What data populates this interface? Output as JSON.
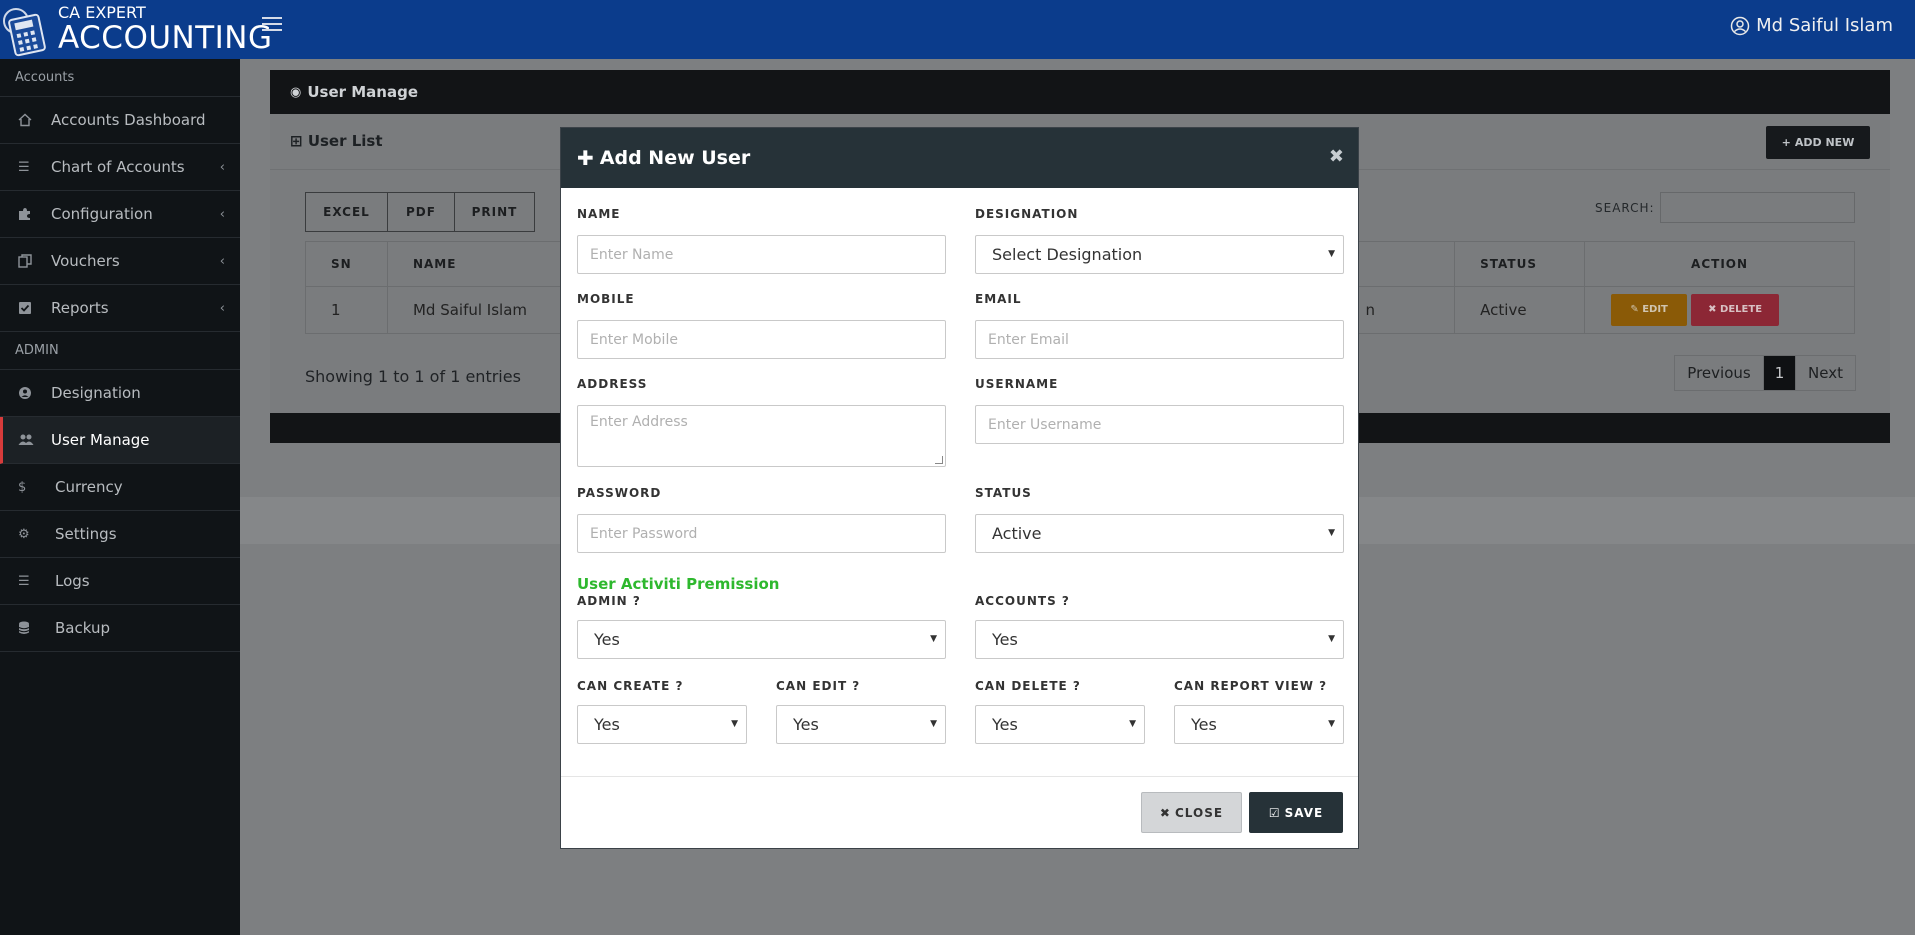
{
  "app": {
    "logo_line1": "CA EXPERT",
    "logo_line2": "ACCOUNTING",
    "user_name": "Md Saiful Islam"
  },
  "sidebar": {
    "section1": "Accounts",
    "section2": "ADMIN",
    "items": [
      {
        "label": "Accounts Dashboard",
        "icon": "home-icon"
      },
      {
        "label": "Chart of Accounts",
        "icon": "list-icon",
        "chevron": "‹"
      },
      {
        "label": "Configuration",
        "icon": "puzzle-icon",
        "chevron": "‹"
      },
      {
        "label": "Vouchers",
        "icon": "copy-icon",
        "chevron": "‹"
      },
      {
        "label": "Reports",
        "icon": "check-square-icon",
        "chevron": "‹"
      },
      {
        "label": "Designation",
        "icon": "user-circle-icon"
      },
      {
        "label": "User Manage",
        "icon": "users-icon"
      },
      {
        "label": "Currency",
        "icon": "dollar-icon"
      },
      {
        "label": "Settings",
        "icon": "cogs-icon"
      },
      {
        "label": "Logs",
        "icon": "list-icon"
      },
      {
        "label": "Backup",
        "icon": "database-icon"
      }
    ]
  },
  "page": {
    "title": "User Manage",
    "list_title": "User List",
    "add_new": "ADD NEW",
    "export": {
      "excel": "EXCEL",
      "pdf": "PDF",
      "print": "PRINT"
    },
    "search_label": "SEARCH:",
    "table": {
      "headers": {
        "sn": "SN",
        "name": "NAME",
        "status": "STATUS",
        "action": "ACTION"
      },
      "row": {
        "sn": "1",
        "name": "Md Saiful Islam",
        "hidden_tail": "n",
        "status": "Active",
        "edit": "EDIT",
        "delete": "DELETE"
      }
    },
    "showing": "Showing 1 to 1 of 1 entries",
    "pager": {
      "prev": "Previous",
      "current": "1",
      "next": "Next"
    }
  },
  "modal": {
    "title": "Add New User",
    "close_x": "×",
    "fields": {
      "name": {
        "label": "NAME",
        "placeholder": "Enter Name"
      },
      "designation": {
        "label": "DESIGNATION",
        "value": "Select Designation"
      },
      "mobile": {
        "label": "MOBILE",
        "placeholder": "Enter Mobile"
      },
      "email": {
        "label": "EMAIL",
        "placeholder": "Enter Email"
      },
      "address": {
        "label": "ADDRESS",
        "placeholder": "Enter Address"
      },
      "username": {
        "label": "USERNAME",
        "placeholder": "Enter Username"
      },
      "password": {
        "label": "PASSWORD",
        "placeholder": "Enter Password"
      },
      "status": {
        "label": "STATUS",
        "value": "Active"
      }
    },
    "permission_title": "User Activiti Premission",
    "perms": {
      "admin": {
        "label": "ADMIN ?",
        "value": "Yes"
      },
      "accounts": {
        "label": "ACCOUNTS ?",
        "value": "Yes"
      },
      "can_create": {
        "label": "CAN CREATE ?",
        "value": "Yes"
      },
      "can_edit": {
        "label": "CAN EDIT ?",
        "value": "Yes"
      },
      "can_delete": {
        "label": "CAN DELETE ?",
        "value": "Yes"
      },
      "can_report_view": {
        "label": "CAN REPORT VIEW ?",
        "value": "Yes"
      }
    },
    "buttons": {
      "close": "CLOSE",
      "save": "SAVE"
    }
  },
  "colors": {
    "topbar": "#0b3c8c",
    "sidebar": "#101417",
    "modal_header": "#263238",
    "permission_green": "#2eb82e",
    "active_marker": "#d73b3b"
  }
}
